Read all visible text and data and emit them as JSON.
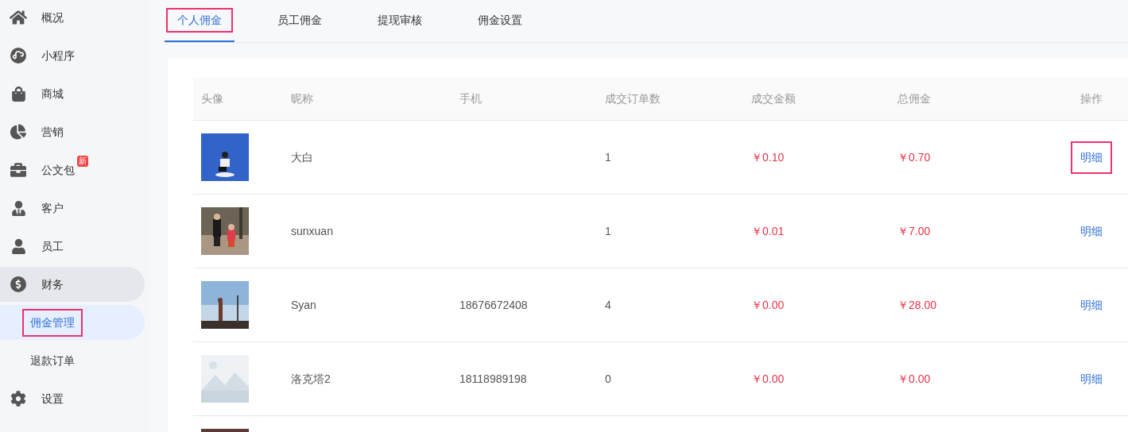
{
  "sidebar": {
    "items": [
      {
        "label": "概况",
        "selected": false
      },
      {
        "label": "小程序",
        "selected": false
      },
      {
        "label": "商城",
        "selected": false
      },
      {
        "label": "营销",
        "selected": false
      },
      {
        "label": "公文包",
        "selected": false,
        "badge": "新"
      },
      {
        "label": "客户",
        "selected": false
      },
      {
        "label": "员工",
        "selected": false
      },
      {
        "label": "财务",
        "selected": true,
        "children": [
          {
            "label": "佣金管理",
            "selected": true,
            "highlighted": true
          },
          {
            "label": "退款订单",
            "selected": false,
            "highlighted": false
          }
        ]
      },
      {
        "label": "设置",
        "selected": false
      }
    ]
  },
  "tabs": [
    {
      "label": "个人佣金",
      "selected": true,
      "highlighted": true
    },
    {
      "label": "员工佣金",
      "selected": false,
      "highlighted": false
    },
    {
      "label": "提现审核",
      "selected": false,
      "highlighted": false
    },
    {
      "label": "佣金设置",
      "selected": false,
      "highlighted": false
    }
  ],
  "table": {
    "columns": [
      "头像",
      "昵称",
      "手机",
      "成交订单数",
      "成交金额",
      "总佣金",
      "操作"
    ],
    "rows": [
      {
        "avatar": {
          "kind": "picture"
        },
        "nickname": "大白",
        "orders": "1",
        "amount": "￥0.10",
        "commission": "￥0.70",
        "action": "明细",
        "action_highlighted": true
      },
      {
        "avatar": {
          "kind": "picture"
        },
        "nickname": "sunxuan",
        "orders": "1",
        "amount": "￥0.01",
        "commission": "￥7.00",
        "action": "明细",
        "action_highlighted": false
      },
      {
        "avatar": {
          "kind": "picture"
        },
        "nickname": "Syan",
        "phone": "18676672408",
        "orders": "4",
        "amount": "￥0.00",
        "commission": "￥28.00",
        "action": "明细",
        "action_highlighted": false
      },
      {
        "avatar": {
          "kind": "picture"
        },
        "nickname": "洛克塔2",
        "phone": "18118989198",
        "orders": "0",
        "amount": "￥0.00",
        "commission": "￥0.00",
        "action": "明细",
        "action_highlighted": false
      },
      {
        "avatar": {
          "kind": "picture"
        }
      }
    ]
  }
}
